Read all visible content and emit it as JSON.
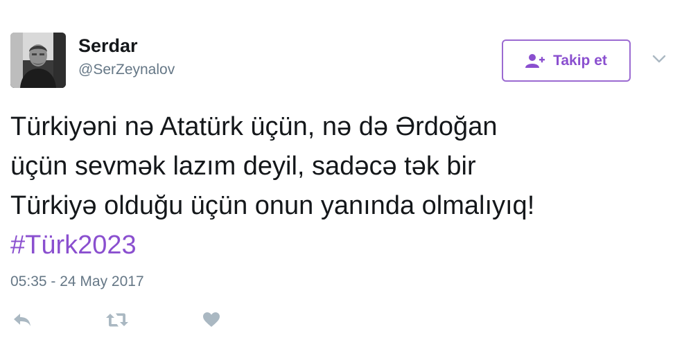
{
  "author": {
    "display_name": "Serdar",
    "handle": "@SerZeynalov",
    "avatar_icon": "profile-photo"
  },
  "follow_button": {
    "label": "Takip et",
    "icon": "add-user-icon",
    "color": "#8a4fcf"
  },
  "menu": {
    "icon": "chevron-down-icon"
  },
  "tweet": {
    "lines": [
      "Türkiyəni nə Atatürk üçün, nə də Ərdoğan",
      "üçün sevmək lazım deyil, sadəcə tək bir",
      "Türkiyə olduğu üçün onun yanında olmalıyıq!"
    ],
    "hashtag": "#Türk2023",
    "hashtag_color": "#8a4fcf"
  },
  "timestamp": "05:35 - 24 May 2017",
  "actions": [
    {
      "name": "reply",
      "icon": "reply-icon"
    },
    {
      "name": "retweet",
      "icon": "retweet-icon"
    },
    {
      "name": "like",
      "icon": "heart-icon"
    }
  ],
  "colors": {
    "text": "#14171a",
    "secondary": "#657786",
    "action_icon": "#aab8c2"
  }
}
